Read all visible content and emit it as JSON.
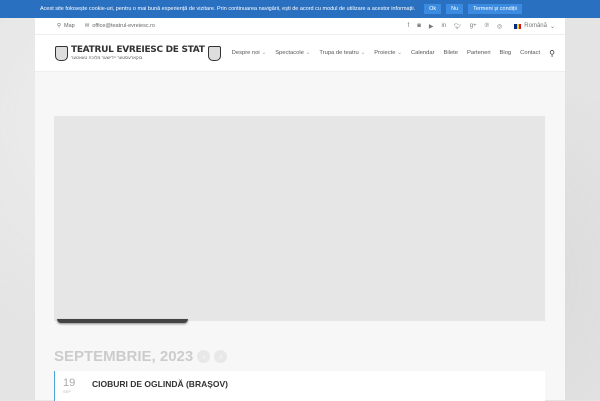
{
  "cookie": {
    "text": "Acest site folosește cookie-uri, pentru o mai bună experiență de vizitare. Prin continuarea navigării, ești de acord cu modul de utilizare a acestor informații.",
    "ok": "Ok",
    "no": "Nu",
    "terms": "Termeni și condiții"
  },
  "topbar": {
    "map": "Map",
    "email": "office@teatrul-evreiesc.ro",
    "language": "Română"
  },
  "logo": {
    "title": "TEATRUL EVREIESC DE STAT",
    "subtitle": "בוקארעסטער יידישער מלוכה טעאטער"
  },
  "nav": [
    "Despre noi",
    "Spectacole",
    "Trupa de teatru",
    "Proiecte",
    "Calendar",
    "Bilete",
    "Parteneri",
    "Blog",
    "Contact"
  ],
  "calendar": {
    "month": "SEPTEMBRIE, 2023",
    "events": [
      {
        "day": "19",
        "mon": "SEP",
        "title": "CIOBURI DE OGLINDĂ (BRAȘOV)"
      }
    ]
  }
}
